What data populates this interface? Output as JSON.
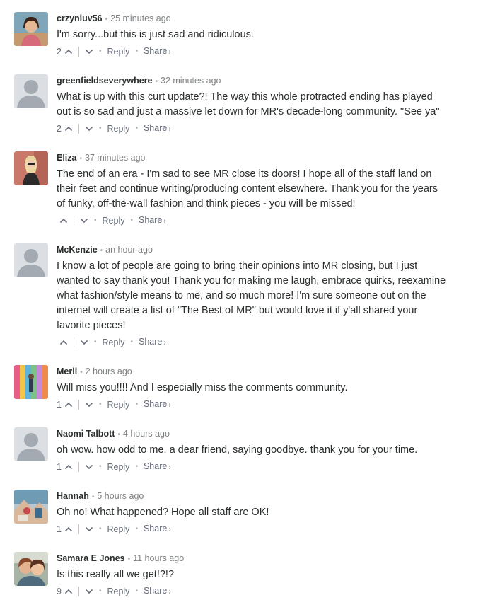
{
  "footer_labels": {
    "reply": "Reply",
    "share": "Share",
    "share_arrow": "›"
  },
  "comments": [
    {
      "author": "crzynluv56",
      "time": "25 minutes ago",
      "lines": [
        "I'm sorry...but this is just sad and ridiculous."
      ],
      "votes": "2",
      "avatar": "photo"
    },
    {
      "author": "greenfieldseverywhere",
      "time": "32 minutes ago",
      "lines": [
        "What is up with this curt update?! The way this whole protracted ending has played",
        "out is so sad and just a massive let down for MR's decade-long community. \"See ya\""
      ],
      "votes": "2",
      "avatar": "default"
    },
    {
      "author": "Eliza",
      "time": "37 minutes ago",
      "lines": [
        "The end of an era - I'm sad to see MR close its doors! I hope all of the staff land on",
        "their feet and continue writing/producing content elsewhere. Thank you for the years",
        "of funky, off-the-wall fashion and think pieces - you will be missed!"
      ],
      "votes": "",
      "avatar": "photo"
    },
    {
      "author": "McKenzie",
      "time": "an hour ago",
      "lines": [
        "I know a lot of people are going to bring their opinions into MR closing, but I just",
        "wanted to say thank you! Thank you for making me laugh, embrace quirks, reexamine",
        "what fashion/style means to me, and so much more! I'm sure someone out on the",
        "internet will create a list of \"The Best of MR\" but would love it if y'all shared your",
        "favorite pieces!"
      ],
      "votes": "",
      "avatar": "default"
    },
    {
      "author": "Merli",
      "time": "2 hours ago",
      "lines": [
        "Will miss you!!!! And I especially miss the comments community."
      ],
      "votes": "1",
      "avatar": "photo"
    },
    {
      "author": "Naomi Talbott",
      "time": "4 hours ago",
      "lines": [
        "oh wow. how odd to me. a dear friend, saying goodbye. thank you for your time."
      ],
      "votes": "1",
      "avatar": "default"
    },
    {
      "author": "Hannah",
      "time": "5 hours ago",
      "lines": [
        "Oh no! What happened? Hope all staff are OK!"
      ],
      "votes": "1",
      "avatar": "photo"
    },
    {
      "author": "Samara E Jones",
      "time": "11 hours ago",
      "lines": [
        "Is this really all we get!?!?"
      ],
      "votes": "9",
      "avatar": "photo"
    }
  ]
}
